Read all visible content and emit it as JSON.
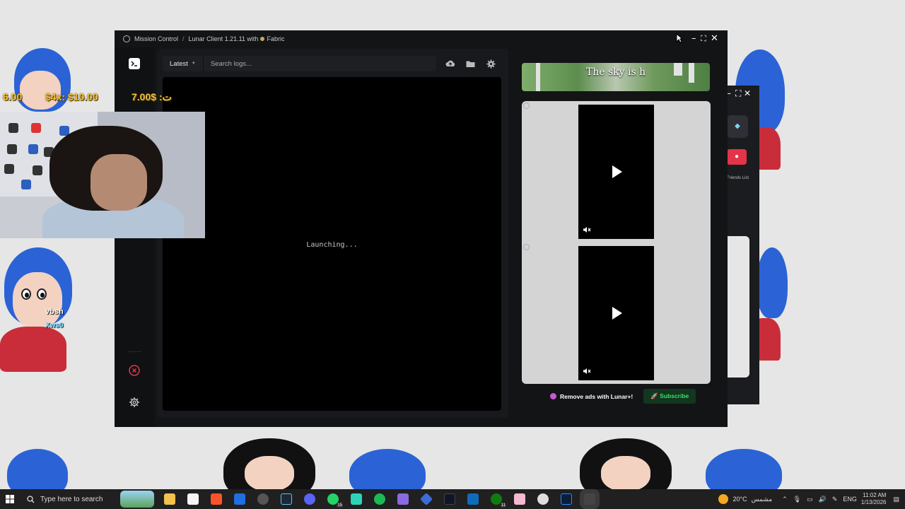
{
  "overlay": {
    "donation_1": "6.00",
    "donation_2": "$4x: $10.00",
    "donation_3": "7.00$ :ت",
    "chat_name": "vbsh",
    "chat_msg": "Xws0"
  },
  "main_window": {
    "title_app": "Mission Control",
    "title_sep": "/",
    "title_client": "Lunar Client 1.21.11 with",
    "title_loader": "Fabric",
    "controls": {
      "minimize": "–",
      "maximize": "⛶",
      "close": "✕"
    }
  },
  "logs": {
    "dropdown_label": "Latest",
    "search_placeholder": "Search logs...",
    "status": "Launching..."
  },
  "ads": {
    "banner_title": "The sky is h"
  },
  "promo": {
    "remove_ads": "Remove ads with Lunar+!",
    "subscribe": "Subscribe"
  },
  "second_window": {
    "friends_label": "Friends List"
  },
  "taskbar": {
    "search_placeholder": "Type here to search",
    "whatsapp_badge": "15",
    "xbox_badge": "11",
    "weather_temp": "20°C",
    "weather_desc": "مشمس",
    "language": "ENG",
    "time": "11:02 AM",
    "date": "1/13/2026"
  }
}
